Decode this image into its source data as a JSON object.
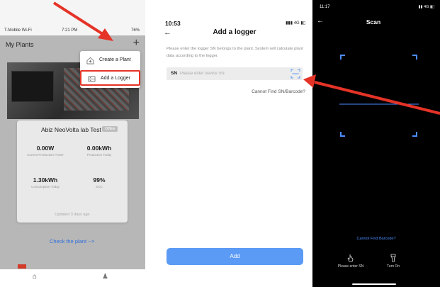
{
  "panel_plants": {
    "status_bar": {
      "carrier": "T-Mobile Wi-Fi",
      "time": "7:21 PM",
      "battery": "76%"
    },
    "title": "My Plants",
    "plus_icon": "+",
    "menu": [
      {
        "icon": "create-plant-icon",
        "label": "Create a Plant"
      },
      {
        "icon": "logger-icon",
        "label": "Add a Logger",
        "highlighted": true
      }
    ],
    "plant_card": {
      "name": "Abiz NeoVolta lab Test",
      "badge": "Offline",
      "metrics": [
        {
          "value": "0.00W",
          "label": "Current Production Power"
        },
        {
          "value": "0.00kWh",
          "label": "Production Today"
        },
        {
          "value": "1.30kWh",
          "label": "Consumption-Today"
        },
        {
          "value": "99%",
          "label": "SOC"
        }
      ],
      "updated": "Updated 3 days ago"
    },
    "check_link": "Check the plant -->",
    "tabbar": [
      {
        "icon": "home-icon"
      },
      {
        "icon": "user-icon"
      }
    ]
  },
  "panel_add_logger": {
    "status_bar": {
      "time": "10:53",
      "signal": "4G"
    },
    "title": "Add a logger",
    "description": "Please enter the logger SN belongs to the plant. System will calculate plant data according to the logger.",
    "sn_label": "SN",
    "sn_placeholder": "Please enter device SN",
    "cannot_find": "Cannot Find SN/Barcode?",
    "add_button": "Add"
  },
  "panel_scan": {
    "status_bar": {
      "time": "11:17",
      "signal": "4G"
    },
    "title": "Scan",
    "cannot_find": "Cannot Find Barcode?",
    "tools": [
      {
        "icon": "hand-pointer-icon",
        "label": "Please enter SN"
      },
      {
        "icon": "flashlight-icon",
        "label": "Turn On"
      }
    ]
  },
  "colors": {
    "accent_blue": "#5b9af5",
    "link_blue": "#2f6fdb",
    "annotation_red": "#e53327",
    "scan_frame": "#4d8dff"
  }
}
